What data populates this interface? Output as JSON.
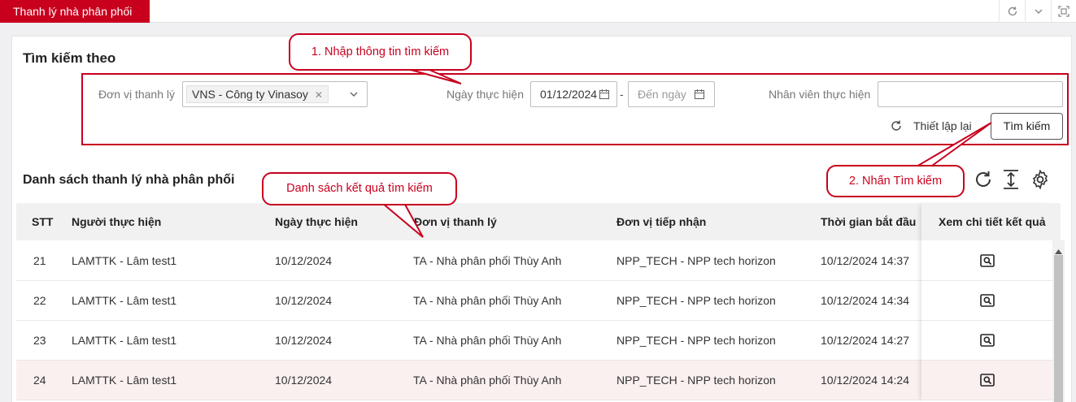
{
  "header": {
    "active_tab": "Thanh lý nhà phân phối"
  },
  "search": {
    "title": "Tìm kiếm theo",
    "unit_label": "Đơn vị thanh lý",
    "unit_value": "VNS - Công ty Vinasoy",
    "date_label": "Ngày thực hiện",
    "date_from": "01/12/2024",
    "date_separator": "-",
    "date_to_placeholder": "Đến ngày",
    "employee_label": "Nhân viên thực hiện",
    "employee_value": "",
    "reset_label": "Thiết lập lại",
    "search_label": "Tìm kiếm"
  },
  "annotations": {
    "step1": "1. Nhập thông tin tìm kiếm",
    "step2": "2. Nhấn Tìm kiếm",
    "results": "Danh sách kết quả tìm kiếm"
  },
  "list": {
    "title": "Danh sách thanh lý nhà phân phối",
    "columns": [
      "STT",
      "Người thực hiện",
      "Ngày thực hiện",
      "Đơn vị thanh lý",
      "Đơn vị tiếp nhận",
      "Thời gian bắt đầu",
      "Xem chi tiết kết quả"
    ],
    "rows": [
      {
        "stt": "21",
        "user": "LAMTTK - Lâm test1",
        "date": "10/12/2024",
        "unit": "TA - Nhà phân phối Thùy Anh",
        "receiver": "NPP_TECH - NPP tech horizon",
        "start": "10/12/2024 14:37"
      },
      {
        "stt": "22",
        "user": "LAMTTK - Lâm test1",
        "date": "10/12/2024",
        "unit": "TA - Nhà phân phối Thùy Anh",
        "receiver": "NPP_TECH - NPP tech horizon",
        "start": "10/12/2024 14:34"
      },
      {
        "stt": "23",
        "user": "LAMTTK - Lâm test1",
        "date": "10/12/2024",
        "unit": "TA - Nhà phân phối Thùy Anh",
        "receiver": "NPP_TECH - NPP tech horizon",
        "start": "10/12/2024 14:27"
      },
      {
        "stt": "24",
        "user": "LAMTTK - Lâm test1",
        "date": "10/12/2024",
        "unit": "TA - Nhà phân phối Thùy Anh",
        "receiver": "NPP_TECH - NPP tech horizon",
        "start": "10/12/2024 14:24"
      }
    ]
  },
  "colors": {
    "brand_red": "#c8001e",
    "highlight_row": "#fbf0f0"
  }
}
